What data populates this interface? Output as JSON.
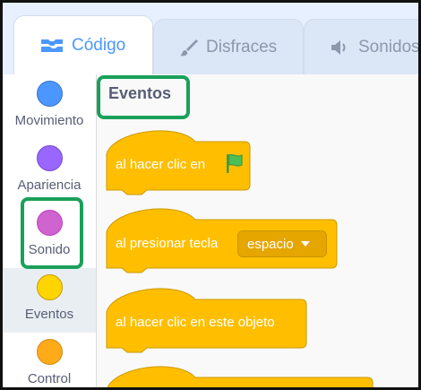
{
  "tabs": [
    {
      "label": "Código",
      "icon": "code-icon",
      "active": true
    },
    {
      "label": "Disfraces",
      "icon": "brush-icon",
      "active": false
    },
    {
      "label": "Sonidos",
      "icon": "speaker-icon",
      "active": false
    }
  ],
  "categories": [
    {
      "label": "Movimiento",
      "color": "#4c97ff"
    },
    {
      "label": "Apariencia",
      "color": "#9966ff"
    },
    {
      "label": "Sonido",
      "color": "#cf63cf"
    },
    {
      "label": "Eventos",
      "color": "#ffd500",
      "selected": true
    },
    {
      "label": "Control",
      "color": "#ffab19"
    }
  ],
  "palette": {
    "heading": "Eventos",
    "blocks": [
      {
        "label": "al hacer clic en",
        "icon": "green-flag-icon"
      },
      {
        "label": "al presionar tecla",
        "dropdown": "espacio"
      },
      {
        "label": "al hacer clic en este objeto"
      }
    ]
  },
  "colors": {
    "events_block": "#ffbf00",
    "highlight": "#1aa05a",
    "accent": "#4c97ff"
  }
}
